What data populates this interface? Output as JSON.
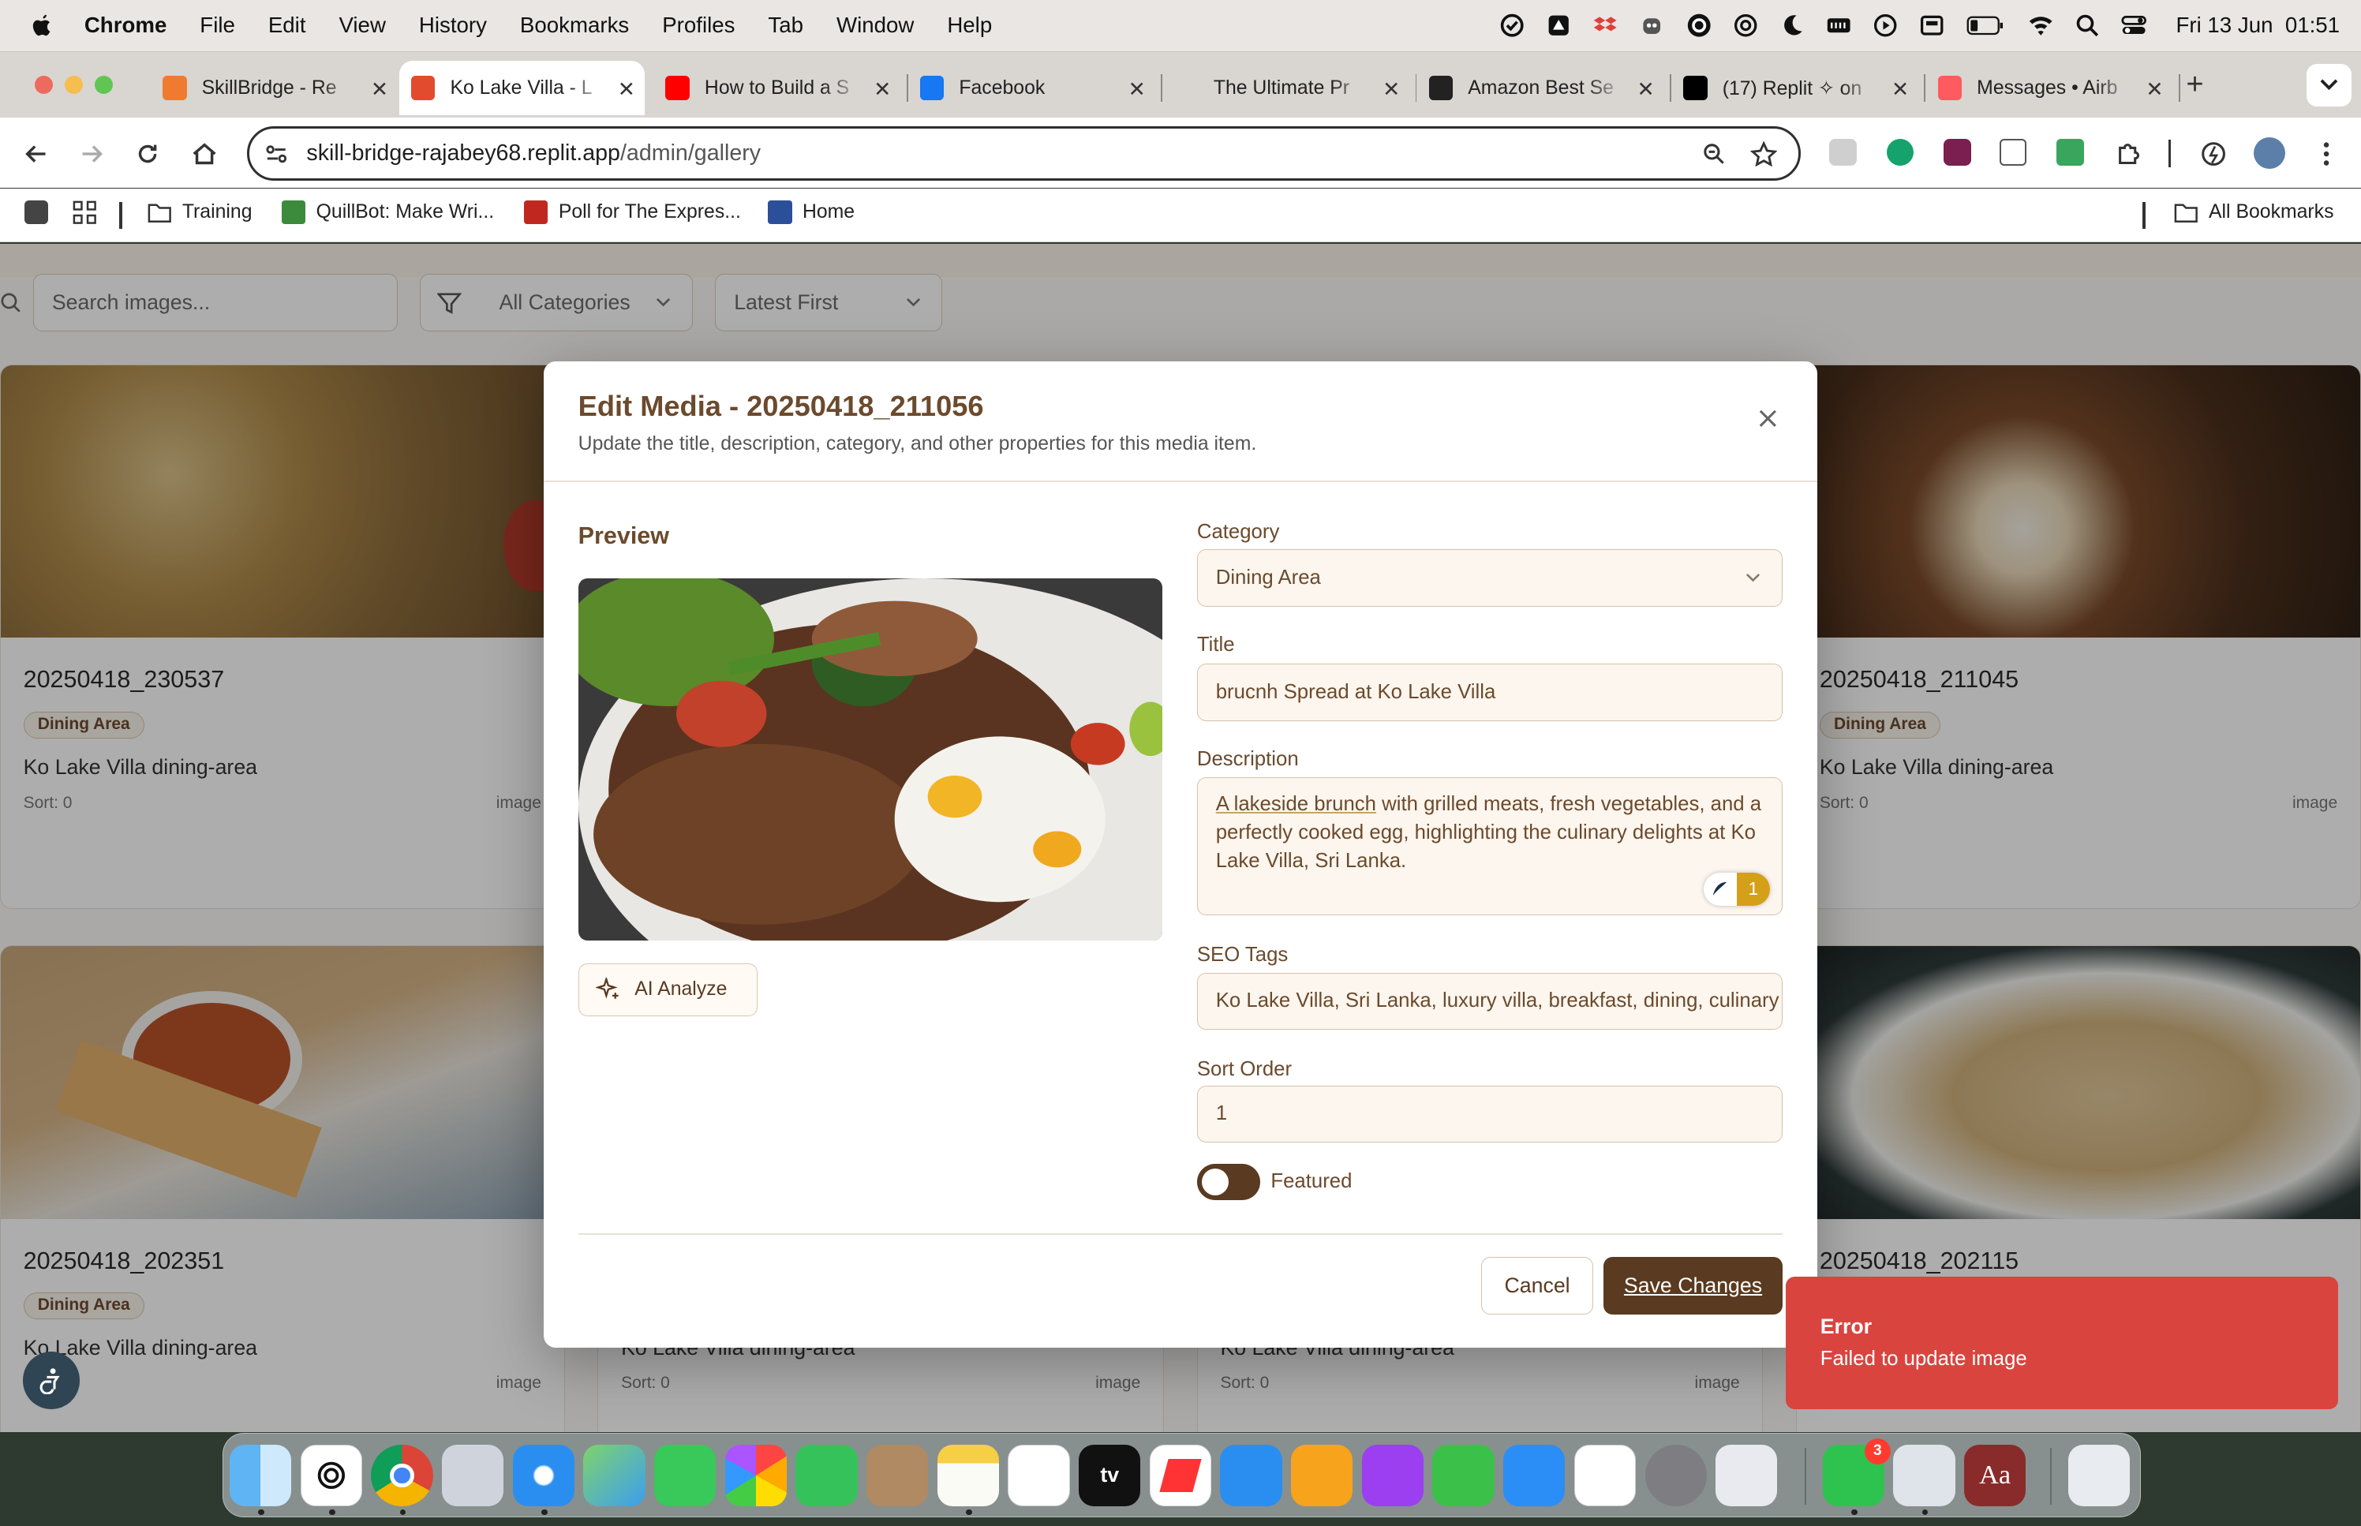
{
  "menubar": {
    "app": "Chrome",
    "items": [
      "File",
      "Edit",
      "View",
      "History",
      "Bookmarks",
      "Profiles",
      "Tab",
      "Window",
      "Help"
    ],
    "datetime": "Fri 13 Jun  01:51"
  },
  "tabs": [
    {
      "title": "SkillBridge - Re",
      "fav": "#f07b2e"
    },
    {
      "title": "Ko Lake Villa - L",
      "fav": "#e34b2f",
      "active": true
    },
    {
      "title": "How to Build a S",
      "fav": "#ff0000"
    },
    {
      "title": "Facebook",
      "fav": "#1877f2"
    },
    {
      "title": "The Ultimate Pr",
      "fav": "#d9d5d1"
    },
    {
      "title": "Amazon Best Se",
      "fav": "#222222"
    },
    {
      "title": "(17) Replit ✧ on",
      "fav": "#000000"
    },
    {
      "title": "Messages • Airb",
      "fav": "#ff5a5f"
    }
  ],
  "address": {
    "host": "skill-bridge-rajabey68.replit.app",
    "path": "/admin/gallery"
  },
  "bookmarks": [
    "Training",
    "QuillBot: Make Wri...",
    "Poll for The Expres...",
    "Home",
    "All Bookmarks"
  ],
  "filters": {
    "search_placeholder": "Search images...",
    "category": "All Categories",
    "sort": "Latest First"
  },
  "cards": [
    {
      "title": "20250418_230537",
      "badge": "Dining Area",
      "desc": "Ko Lake Villa dining-area",
      "sort": "Sort: 0",
      "type": "image"
    },
    {
      "title": "20250418_211045",
      "badge": "Dining Area",
      "desc": "Ko Lake Villa dining-area",
      "sort": "Sort: 0",
      "type": "image"
    },
    {
      "title": "20250418_202351",
      "badge": "Dining Area",
      "desc": "Ko Lake Villa dining-area",
      "sort": "Sort: 0",
      "type": "image"
    },
    {
      "title": "20250418_202115",
      "badge": "",
      "desc": "",
      "sort": "",
      "type": ""
    },
    {
      "title": "",
      "badge": "",
      "desc": "Ko Lake Villa dining-area",
      "sort": "Sort: 0",
      "type": "image"
    },
    {
      "title": "",
      "badge": "",
      "desc": "Ko Lake Villa dining-area",
      "sort": "Sort: 0",
      "type": "image"
    }
  ],
  "modal": {
    "title": "Edit Media - 20250418_211056",
    "subtitle": "Update the title, description, category, and other properties for this media item.",
    "preview_label": "Preview",
    "ai_button": "AI Analyze",
    "category_label": "Category",
    "category_value": "Dining Area",
    "title_label": "Title",
    "title_value": "brucnh Spread at Ko Lake Villa",
    "description_label": "Description",
    "description_link": "A lakeside brunch",
    "description_rest": " with grilled meats, fresh vegetables, and a perfectly cooked egg, highlighting the culinary delights at Ko Lake Villa, Sri Lanka.",
    "grammar_count": "1",
    "seo_label": "SEO Tags",
    "seo_value": "Ko Lake Villa, Sri Lanka, luxury villa, breakfast, dining, culinary",
    "sort_label": "Sort Order",
    "sort_value": "1",
    "featured_label": "Featured",
    "featured_on": false,
    "cancel": "Cancel",
    "save": "Save Changes"
  },
  "toast": {
    "title": "Error",
    "message": "Failed to update image"
  },
  "dock": {
    "whatsapp_badge": "3",
    "dictionary_label": "Aa",
    "appletv_label": "tv"
  }
}
